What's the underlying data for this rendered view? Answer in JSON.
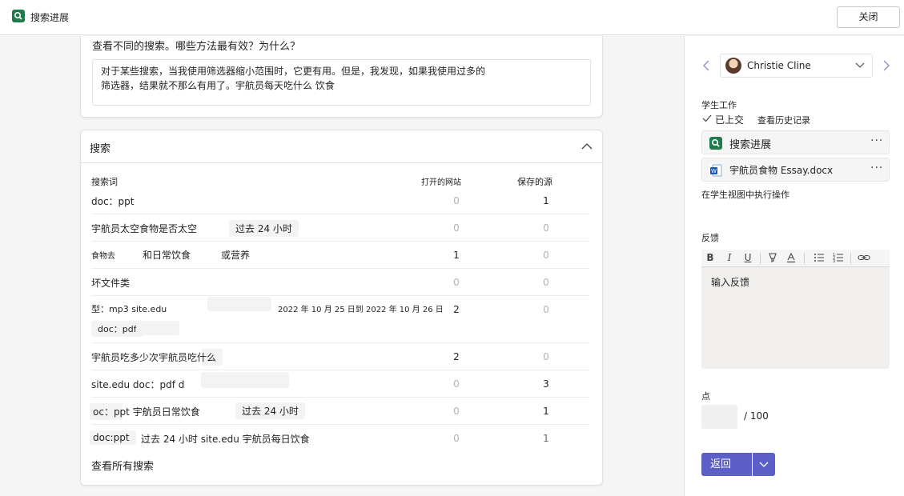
{
  "app": {
    "title": "搜索进展",
    "close_label": "关闭"
  },
  "question_card": {
    "question": "查看不同的搜索。哪些方法最有效？为什么？",
    "answer_line1": "对于某些搜索，当我使用筛选器缩小范围时，它更有用。但是，我发现，如果我使用过多的",
    "answer_line2": "筛选器，结果就不那么有用了。宇航员每天吃什么 饮食"
  },
  "search_card": {
    "title": "搜索",
    "columns": {
      "term": "搜索词",
      "opened": "打开的网站",
      "saved": "保存的源"
    },
    "rows": [
      {
        "parts": [
          "doc：ppt"
        ],
        "opened": "0",
        "saved": "1"
      },
      {
        "parts": [
          "宇航员太空食物是否太空",
          "过去 24 小时"
        ],
        "opened": "0",
        "saved": "0"
      },
      {
        "parts": [
          "食物去",
          "和日常饮食",
          "或营养"
        ],
        "opened": "1",
        "saved": "0"
      },
      {
        "parts": [
          "坏文件类"
        ],
        "opened": "0",
        "saved": "0"
      },
      {
        "parts": [
          "型：mp3 site.edu",
          "2022 年 10 月 25 日到 2022 年 10 月 26 日",
          "doc：pdf"
        ],
        "opened": "2",
        "saved": "0"
      },
      {
        "parts": [
          "宇航员吃多少次宇航员吃什么"
        ],
        "opened": "2",
        "saved": "0"
      },
      {
        "parts": [
          "site.edu doc：pdf d"
        ],
        "opened": "0",
        "saved": "3"
      },
      {
        "parts": [
          "oc：ppt 宇航员日常饮食",
          "过去 24 小时"
        ],
        "opened": "0",
        "saved": "1"
      },
      {
        "parts": [
          "doc:ppt",
          "过去 24 小时 site.edu 宇航员每日饮食"
        ],
        "opened": "0",
        "saved": "1"
      }
    ],
    "view_all": "查看所有搜索"
  },
  "panel": {
    "student_name": "Christie Cline",
    "student_work_label": "学生工作",
    "submitted_label": "已上交",
    "history_label": "查看历史记录",
    "files": [
      {
        "name": "搜索进展",
        "icon": "search-progress-icon",
        "color": "#1f7a4d"
      },
      {
        "name": "宇航员食物 Essay.docx",
        "icon": "word-doc-icon",
        "color": "#185abd"
      }
    ],
    "student_view_label": "在学生视图中执行操作",
    "feedback_label": "反馈",
    "feedback_placeholder": "输入反馈",
    "points_label": "点",
    "points_total": "/ 100",
    "return_label": "返回"
  },
  "colors": {
    "accent": "#5b5fc7",
    "app_green": "#1f7a4d",
    "word_blue": "#185abd"
  }
}
